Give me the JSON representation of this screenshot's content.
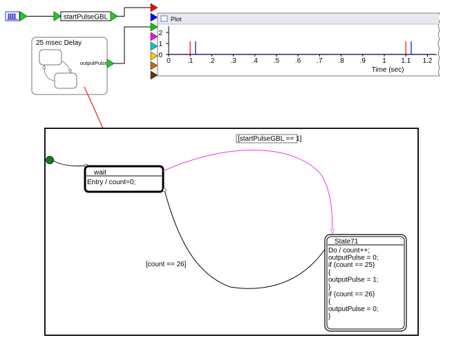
{
  "source_block": {
    "icon": "pulse-train-icon"
  },
  "gbl_block": {
    "label": "startPulseGBL"
  },
  "delay_block": {
    "title": "25 msec Delay",
    "output_label": "outputPulse"
  },
  "plot": {
    "title": "Plot",
    "y_ticks": [
      "2",
      "1",
      "0"
    ],
    "x_ticks": [
      "0",
      ".1",
      ".2",
      ".3",
      ".4",
      ".5",
      ".6",
      ".7",
      ".8",
      ".9",
      "1",
      "1.1",
      "1.2"
    ],
    "x_label": "Time (sec)",
    "input_colors": [
      "#ff0000",
      "#0000ff",
      "#00cc00",
      "#ff00ff",
      "#00cccc",
      "#ffcc00",
      "#cc6600",
      "#663300"
    ]
  },
  "chart_data": {
    "type": "line",
    "x_ticks": [
      0,
      0.1,
      0.2,
      0.3,
      0.4,
      0.5,
      0.6,
      0.7,
      0.8,
      0.9,
      1.0,
      1.1,
      1.2
    ],
    "y_ticks": [
      0,
      1,
      2
    ],
    "series": [
      {
        "color": "#ff0000",
        "pulses": [
          0.1,
          1.1
        ]
      },
      {
        "color": "#0000ff",
        "pulses": [
          0.125,
          1.125
        ]
      }
    ]
  },
  "statechart": {
    "transition_top": "[startPulseGBL == 1]",
    "transition_bottom": "[count == 26]",
    "wait_state": {
      "name": "wait",
      "action": "Entry / count=0;"
    },
    "state71": {
      "name": "State71",
      "lines": [
        "Do / count++;",
        "outputPulse = 0;",
        "if (count == 25)",
        "{",
        "outputPulse = 1;",
        "}",
        "if (count == 26)",
        "{",
        "outputPulse = 0;",
        "}"
      ]
    }
  }
}
